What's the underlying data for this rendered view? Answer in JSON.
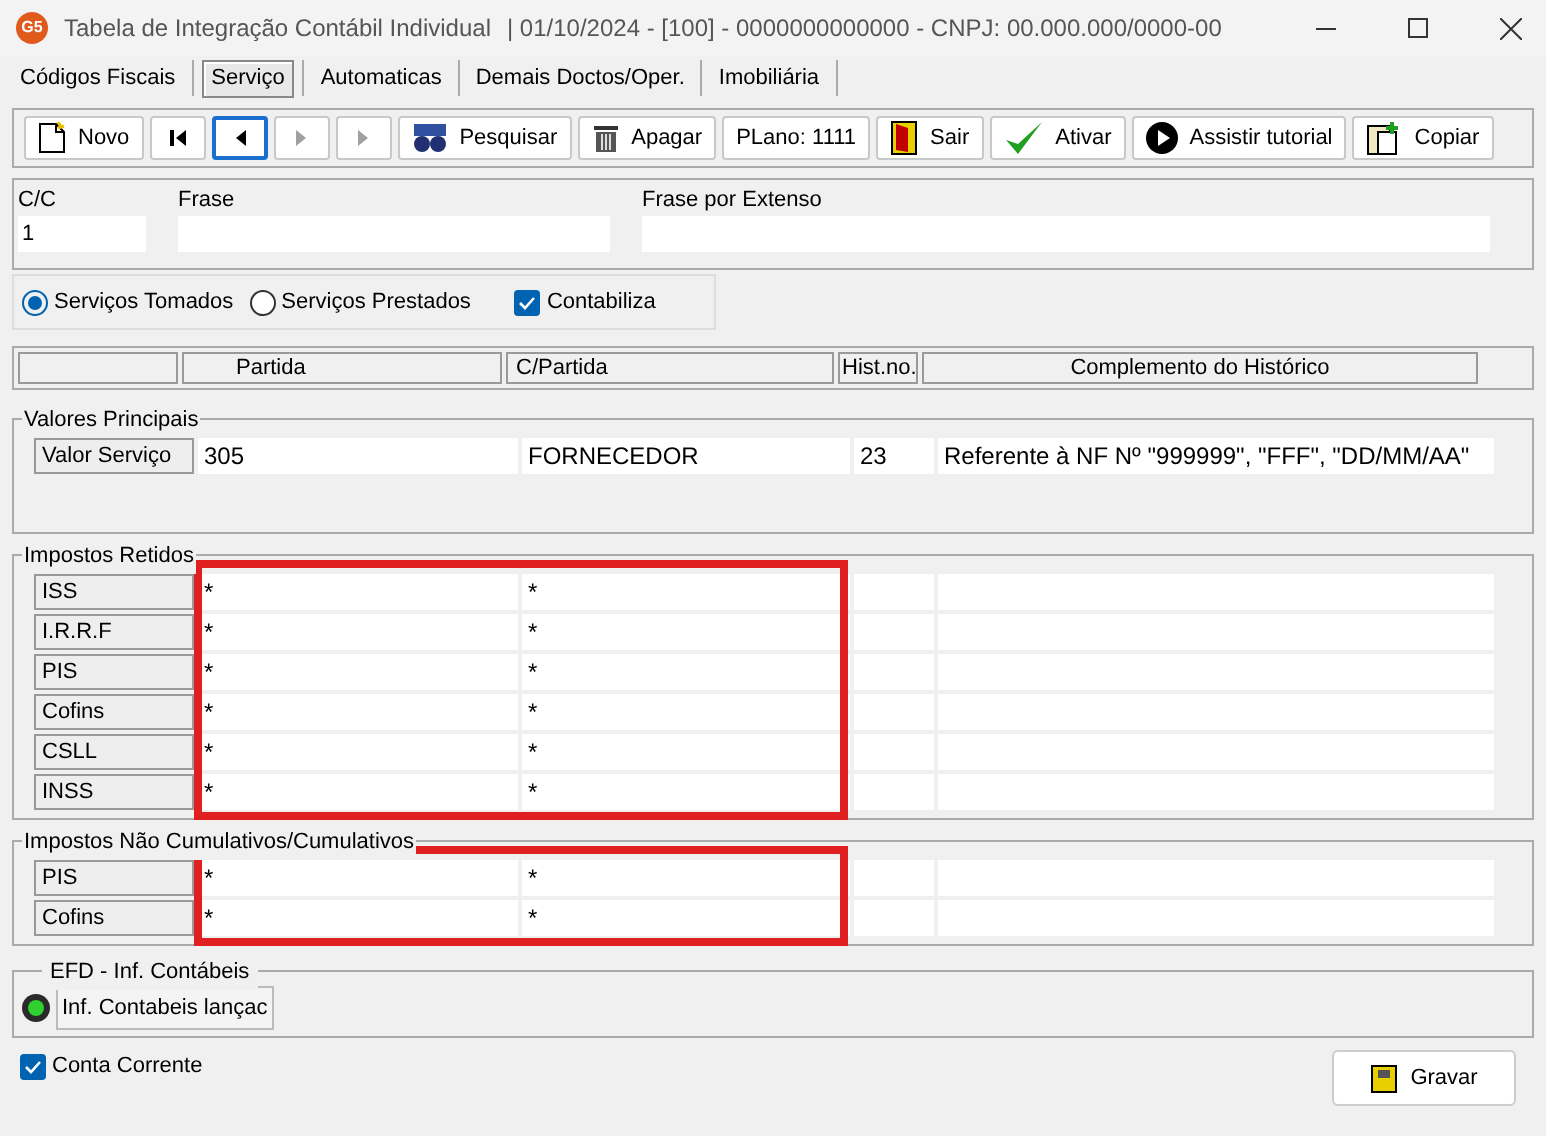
{
  "window": {
    "title": "Tabela de Integração Contábil Individual",
    "subtitle": "|  01/10/2024 - [100] - 0000000000000 - CNPJ: 00.000.000/0000-00",
    "logo": "G5"
  },
  "tabs": [
    {
      "label": "Códigos Fiscais",
      "selected": false
    },
    {
      "label": "Serviço",
      "selected": true
    },
    {
      "label": "Automaticas",
      "selected": false
    },
    {
      "label": "Demais Doctos/Oper.",
      "selected": false
    },
    {
      "label": "Imobiliária",
      "selected": false
    }
  ],
  "toolbar": [
    {
      "kind": "new",
      "label": "Novo",
      "disabled": false,
      "focused": false
    },
    {
      "kind": "first",
      "disabled": false,
      "focused": false
    },
    {
      "kind": "prev",
      "disabled": false,
      "focused": true
    },
    {
      "kind": "next",
      "disabled": true,
      "focused": false
    },
    {
      "kind": "last",
      "disabled": true,
      "focused": false
    },
    {
      "kind": "search",
      "label": "Pesquisar",
      "disabled": false,
      "focused": false
    },
    {
      "kind": "delete",
      "label": "Apagar",
      "disabled": false,
      "focused": false
    },
    {
      "kind": "plain",
      "label": "PLano: 1111",
      "disabled": false,
      "focused": false
    },
    {
      "kind": "exit",
      "label": "Sair",
      "disabled": false,
      "focused": false
    },
    {
      "kind": "activate",
      "label": "Ativar",
      "disabled": false,
      "focused": false
    },
    {
      "kind": "play",
      "label": "Assistir tutorial",
      "disabled": false,
      "focused": false
    },
    {
      "kind": "copy",
      "label": "Copiar",
      "disabled": false,
      "focused": false
    }
  ],
  "header_fields": [
    {
      "label": "C/C",
      "value": "1"
    },
    {
      "label": "Frase"
    },
    {
      "label": "Frase por Extenso"
    }
  ],
  "options": {
    "radios": [
      {
        "label": "Serviços Tomados",
        "selected": true
      },
      {
        "label": "Serviços Prestados",
        "selected": false
      }
    ],
    "checkbox": {
      "label": "Contabiliza",
      "checked": true
    }
  },
  "columns": [
    "Partida",
    "C/Partida",
    "Hist.no.",
    "Complemento do Histórico"
  ],
  "groups": [
    {
      "title": "Valores Principais",
      "highlighted": false,
      "rows": [
        {
          "label": "Valor Serviço",
          "cells": [
            "305",
            "FORNECEDOR",
            "23",
            "Referente à NF Nº \"999999\", \"FFF\", \"DD/MM/AA\""
          ]
        }
      ]
    },
    {
      "title": "Impostos Retidos",
      "highlighted": true,
      "rows": [
        {
          "label": "ISS",
          "cells": [
            "*",
            "*",
            "",
            ""
          ]
        },
        {
          "label": "I.R.R.F",
          "cells": [
            "*",
            "*",
            "",
            ""
          ]
        },
        {
          "label": "PIS",
          "cells": [
            "*",
            "*",
            "",
            ""
          ]
        },
        {
          "label": "Cofins",
          "cells": [
            "*",
            "*",
            "",
            ""
          ]
        },
        {
          "label": "CSLL",
          "cells": [
            "*",
            "*",
            "",
            ""
          ]
        },
        {
          "label": "INSS",
          "cells": [
            "*",
            "*",
            "",
            ""
          ]
        }
      ]
    },
    {
      "title": "Impostos Não Cumulativos/Cumulativos",
      "highlighted": true,
      "rows": [
        {
          "label": "PIS",
          "cells": [
            "*",
            "*",
            "",
            ""
          ]
        },
        {
          "label": "Cofins",
          "cells": [
            "*",
            "*",
            "",
            ""
          ]
        }
      ]
    }
  ],
  "efd": {
    "title": "EFD - Inf. Contábeis",
    "button": "Inf. Contabeis lançac"
  },
  "conta_corrente": {
    "label": "Conta Corrente",
    "checked": true
  },
  "save_button": "Gravar"
}
